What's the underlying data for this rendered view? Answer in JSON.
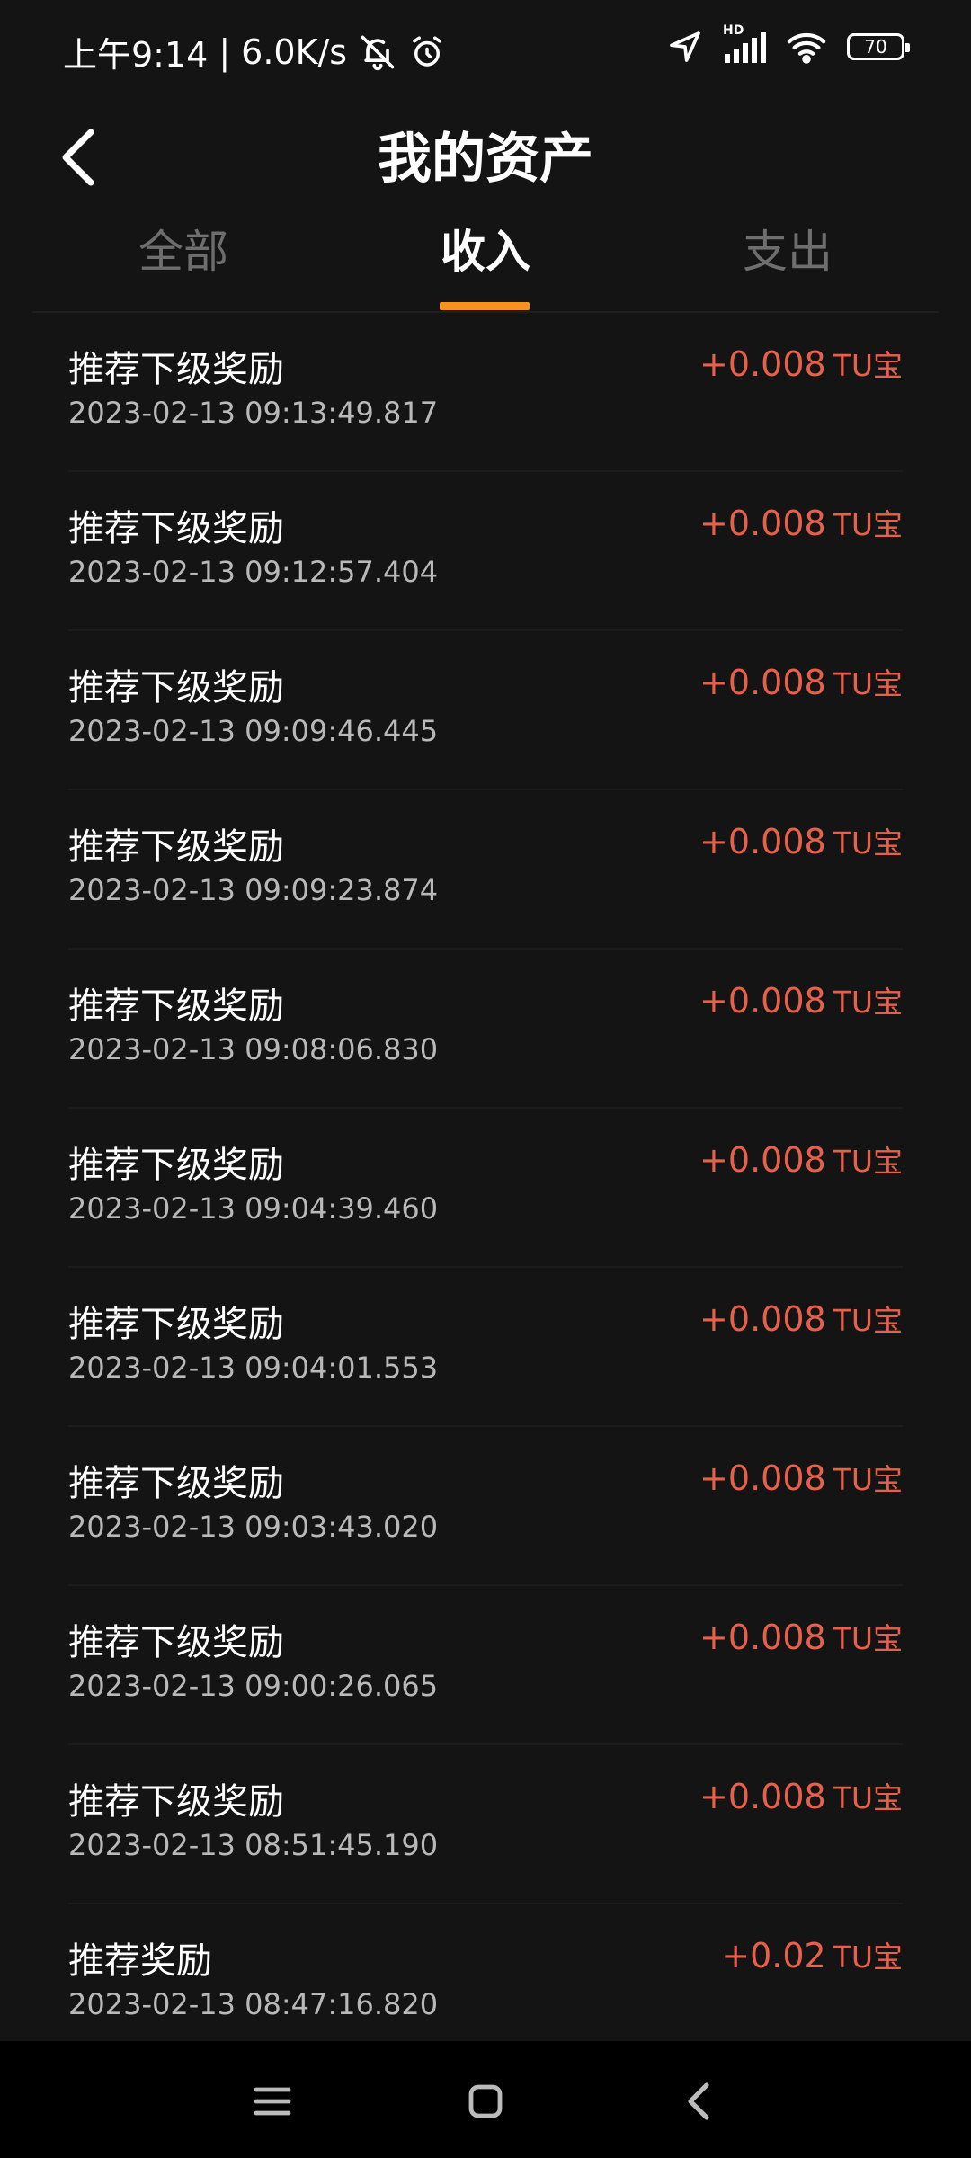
{
  "status_bar": {
    "time": "上午9:14",
    "separator": "|",
    "net_speed": "6.0K/s",
    "signal_label": "HD",
    "battery": "70"
  },
  "header": {
    "title": "我的资产"
  },
  "tabs": [
    {
      "label": "全部",
      "active": false
    },
    {
      "label": "收入",
      "active": true
    },
    {
      "label": "支出",
      "active": false
    }
  ],
  "colors": {
    "accent": "#f7931a",
    "amount": "#e8604a",
    "background": "#141414"
  },
  "records": [
    {
      "title": "推荐下级奖励",
      "time": "2023-02-13 09:13:49.817",
      "amount": "+0.008",
      "unit": "TU宝"
    },
    {
      "title": "推荐下级奖励",
      "time": "2023-02-13 09:12:57.404",
      "amount": "+0.008",
      "unit": "TU宝"
    },
    {
      "title": "推荐下级奖励",
      "time": "2023-02-13 09:09:46.445",
      "amount": "+0.008",
      "unit": "TU宝"
    },
    {
      "title": "推荐下级奖励",
      "time": "2023-02-13 09:09:23.874",
      "amount": "+0.008",
      "unit": "TU宝"
    },
    {
      "title": "推荐下级奖励",
      "time": "2023-02-13 09:08:06.830",
      "amount": "+0.008",
      "unit": "TU宝"
    },
    {
      "title": "推荐下级奖励",
      "time": "2023-02-13 09:04:39.460",
      "amount": "+0.008",
      "unit": "TU宝"
    },
    {
      "title": "推荐下级奖励",
      "time": "2023-02-13 09:04:01.553",
      "amount": "+0.008",
      "unit": "TU宝"
    },
    {
      "title": "推荐下级奖励",
      "time": "2023-02-13 09:03:43.020",
      "amount": "+0.008",
      "unit": "TU宝"
    },
    {
      "title": "推荐下级奖励",
      "time": "2023-02-13 09:00:26.065",
      "amount": "+0.008",
      "unit": "TU宝"
    },
    {
      "title": "推荐下级奖励",
      "time": "2023-02-13 08:51:45.190",
      "amount": "+0.008",
      "unit": "TU宝"
    },
    {
      "title": "推荐奖励",
      "time": "2023-02-13 08:47:16.820",
      "amount": "+0.02",
      "unit": "TU宝"
    }
  ],
  "icons": {
    "back": "back-arrow-icon",
    "mute": "bell-off-icon",
    "alarm": "alarm-clock-icon",
    "location": "location-arrow-icon",
    "signal": "signal-bars-icon",
    "wifi": "wifi-icon",
    "nav_menu": "menu-icon",
    "nav_home": "home-square-icon",
    "nav_back": "chevron-left-icon"
  }
}
